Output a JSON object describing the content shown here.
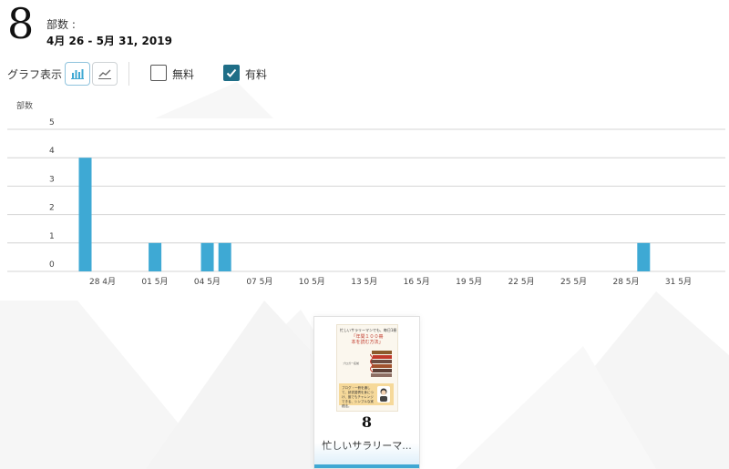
{
  "header": {
    "total": "8",
    "units_label": "部数 :",
    "date_range": "4月 26 - 5月 31, 2019"
  },
  "controls": {
    "graph_label": "グラフ表示",
    "view_options": [
      {
        "icon": "bar-chart-icon",
        "selected": true
      },
      {
        "icon": "line-chart-icon",
        "selected": false
      }
    ],
    "filters": [
      {
        "label": "無料",
        "checked": false
      },
      {
        "label": "有料",
        "checked": true
      }
    ]
  },
  "colors": {
    "bar": "#3ea9d4",
    "checkbox_checked": "#1f6e87",
    "grid": "#d4d4d4"
  },
  "chart_data": {
    "type": "bar",
    "ylabel": "部数",
    "ylim": [
      0,
      5
    ],
    "yticks": [
      "0",
      "1",
      "2",
      "3",
      "4",
      "5"
    ],
    "xtick_labels": [
      "28 4月",
      "01 5月",
      "04 5月",
      "07 5月",
      "10 5月",
      "13 5月",
      "16 5月",
      "19 5月",
      "22 5月",
      "25 5月",
      "28 5月",
      "31 5月"
    ],
    "xtick_days": [
      2,
      5,
      8,
      11,
      14,
      17,
      20,
      23,
      26,
      29,
      32,
      35
    ],
    "x_start": "2019-04-26",
    "bars": [
      {
        "date": "2019-04-28",
        "value": 4
      },
      {
        "date": "2019-05-02",
        "value": 1
      },
      {
        "date": "2019-05-05",
        "value": 1
      },
      {
        "date": "2019-05-06",
        "value": 1
      },
      {
        "date": "2019-05-30",
        "value": 1
      }
    ],
    "bar_days": [
      2,
      6,
      9,
      10,
      34
    ]
  },
  "book": {
    "count": "8",
    "title": "忙しいサラリーマ...",
    "cover": {
      "top_text": "忙しいサラリーマンでも、毎日1冊",
      "title_line1": "「年間１００冊",
      "title_line2": "本を読む方法」",
      "author": "ブロガー名前",
      "banner_text": "ブログ・一冊を通して、読書習慣を身につけ、誰でもチャレンジできる、シンプルな実践法。"
    }
  }
}
